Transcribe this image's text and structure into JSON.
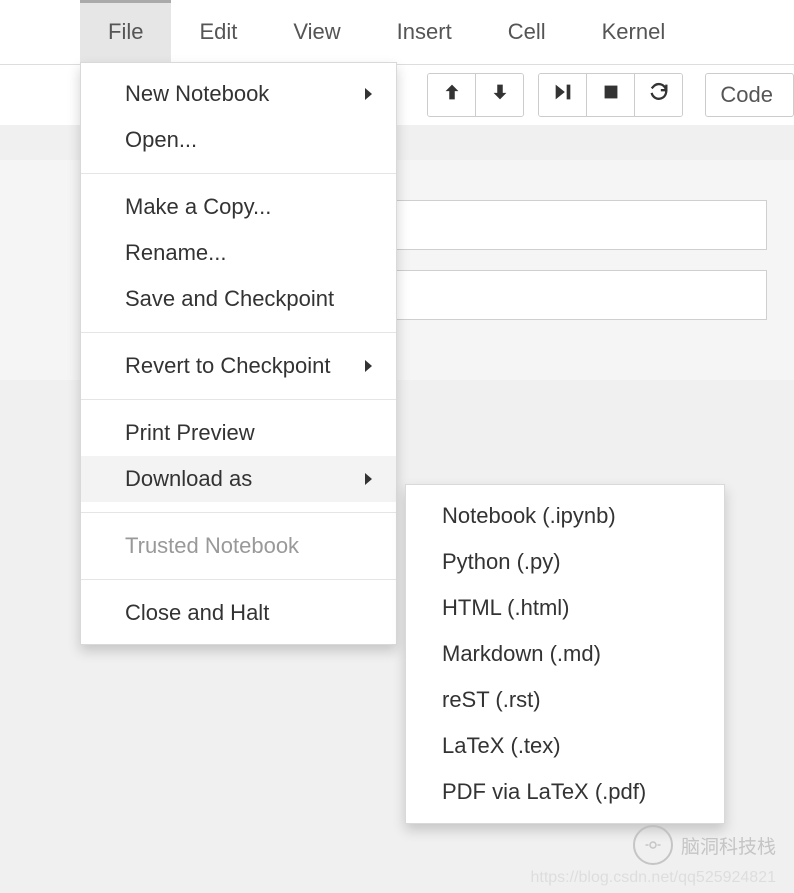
{
  "menubar": {
    "file": "File",
    "edit": "Edit",
    "view": "View",
    "insert": "Insert",
    "cell": "Cell",
    "kernel": "Kernel"
  },
  "toolbar": {
    "celltype": "Code"
  },
  "file_menu": {
    "new_notebook": "New Notebook",
    "open": "Open...",
    "make_copy": "Make a Copy...",
    "rename": "Rename...",
    "save_checkpoint": "Save and Checkpoint",
    "revert": "Revert to Checkpoint",
    "print_preview": "Print Preview",
    "download_as": "Download as",
    "trusted": "Trusted Notebook",
    "close_halt": "Close and Halt"
  },
  "download_as_menu": {
    "ipynb": "Notebook (.ipynb)",
    "py": "Python (.py)",
    "html": "HTML (.html)",
    "md": "Markdown (.md)",
    "rst": "reST (.rst)",
    "tex": "LaTeX (.tex)",
    "pdf": "PDF via LaTeX (.pdf)"
  },
  "watermark": {
    "text": "脑洞科技栈",
    "url": "https://blog.csdn.net/qq525924821"
  }
}
